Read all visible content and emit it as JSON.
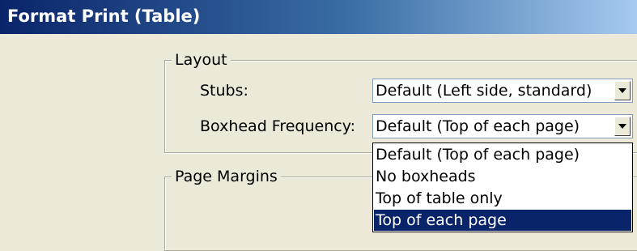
{
  "window": {
    "title": "Format Print (Table)"
  },
  "layout": {
    "legend": "Layout",
    "stubs": {
      "label": "Stubs:",
      "value": "Default (Left side, standard)"
    },
    "boxhead": {
      "label": "Boxhead Frequency:",
      "value": "Default (Top of each page)",
      "options": [
        "Default (Top of each page)",
        "No boxheads",
        "Top of table only",
        "Top of each page"
      ],
      "highlighted": "Top of each page"
    }
  },
  "page_margins": {
    "legend": "Page Margins"
  },
  "colors": {
    "title_bar": "#0a246a",
    "selection": "#0a246a",
    "dialog_bg": "#ece9d8"
  },
  "icons": {
    "dropdown": "chevron-down-icon"
  }
}
